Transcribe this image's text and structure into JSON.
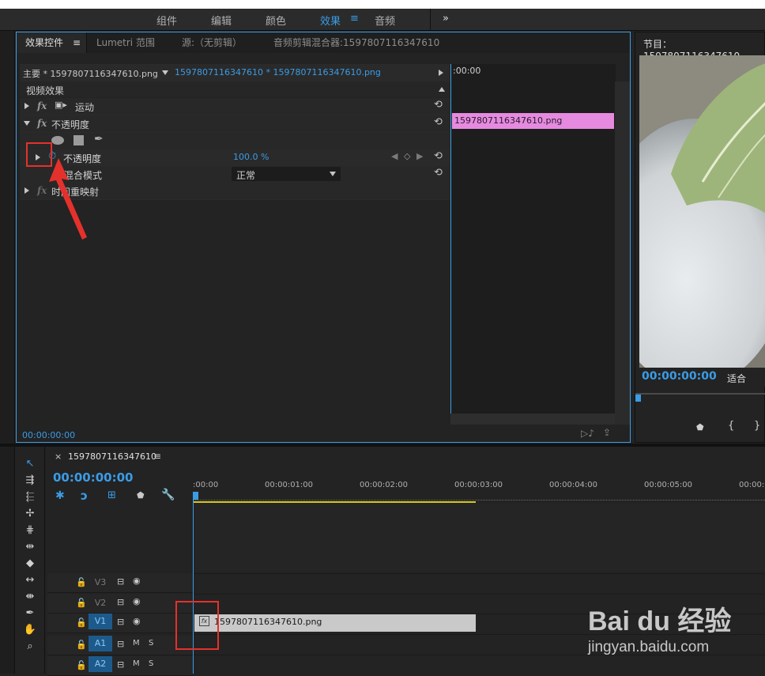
{
  "workspaces": [
    "组件",
    "编辑",
    "颜色",
    "效果",
    "音频"
  ],
  "workspace_active_index": 3,
  "workspace_more": "»",
  "effect_controls": {
    "tabs": [
      "效果控件",
      "Lumetri 范围",
      "源:（无剪辑）",
      "音频剪辑混合器:1597807116347610"
    ],
    "tab_menu": "≡",
    "master_clip": "主要 * 1597807116347610.png",
    "sequence_clip": "1597807116347610 * 1597807116347610.png",
    "section": "视频效果",
    "motion_label": "运动",
    "opacity_group": "不透明度",
    "opacity_label": "不透明度",
    "opacity_value": "100.0 %",
    "blend_label": "混合模式",
    "blend_value": "正常",
    "time_remap": "时间重映射",
    "mini_timecode": ":00:00",
    "mini_clip": "1597807116347610.png",
    "footer_timecode": "00:00:00:00"
  },
  "program": {
    "title": "节目：1597807116347610",
    "timecode": "00:00:00:00",
    "fit": "适合"
  },
  "timeline": {
    "seq_name": "1597807116347610",
    "timecode": "00:00:00:00",
    "ruler": [
      ":00:00",
      "00:00:01:00",
      "00:00:02:00",
      "00:00:03:00",
      "00:00:04:00",
      "00:00:05:00",
      "00:00:0"
    ],
    "tracks": [
      {
        "name": "V3",
        "active": false,
        "kind": "video"
      },
      {
        "name": "V2",
        "active": false,
        "kind": "video"
      },
      {
        "name": "V1",
        "active": true,
        "kind": "video"
      },
      {
        "name": "A1",
        "active": true,
        "kind": "audio"
      },
      {
        "name": "A2",
        "active": true,
        "kind": "audio"
      }
    ],
    "clip_name": "1597807116347610.png",
    "mute_label": "M",
    "solo_label": "S"
  },
  "watermark": {
    "logo": "Bai du 经验",
    "url": "jingyan.baidu.com"
  },
  "colors": {
    "accent": "#3a9ce6",
    "clip_pink": "#e68ae0",
    "annotation": "#e5312c",
    "yellow": "#d7c81d"
  }
}
